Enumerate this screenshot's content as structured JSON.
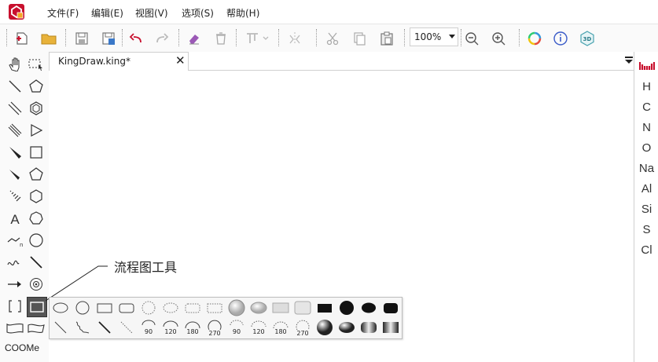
{
  "menu": {
    "items": [
      "文件(F)",
      "编辑(E)",
      "视图(V)",
      "选项(S)",
      "帮助(H)"
    ]
  },
  "toolbar": {
    "zoom_value": "100%",
    "buttons": [
      "new-file-icon",
      "open-folder-icon",
      "save-icon",
      "save-as-icon",
      "undo-icon",
      "redo-icon",
      "eraser-icon",
      "delete-icon",
      "align-icon",
      "flip-icon",
      "cut-icon",
      "copy-icon",
      "paste-icon",
      "zoom-out-icon",
      "zoom-in-icon",
      "color-wheel-icon",
      "info-icon",
      "3d-view-icon"
    ]
  },
  "tabs": [
    {
      "label": "KingDraw.king*",
      "close": "✕"
    }
  ],
  "annotation": {
    "label": "流程图工具"
  },
  "left_tools": {
    "bottom_label": "COOMe"
  },
  "flowchart_tools": {
    "row2_angles": [
      "90",
      "120",
      "180",
      "270",
      "90",
      "120",
      "180",
      "270"
    ]
  },
  "elements": [
    "H",
    "C",
    "N",
    "O",
    "Na",
    "Al",
    "Si",
    "S",
    "Cl"
  ],
  "colors": {
    "accent_red": "#c8102e",
    "text": "#222222",
    "panel_bg": "#fafafa"
  }
}
